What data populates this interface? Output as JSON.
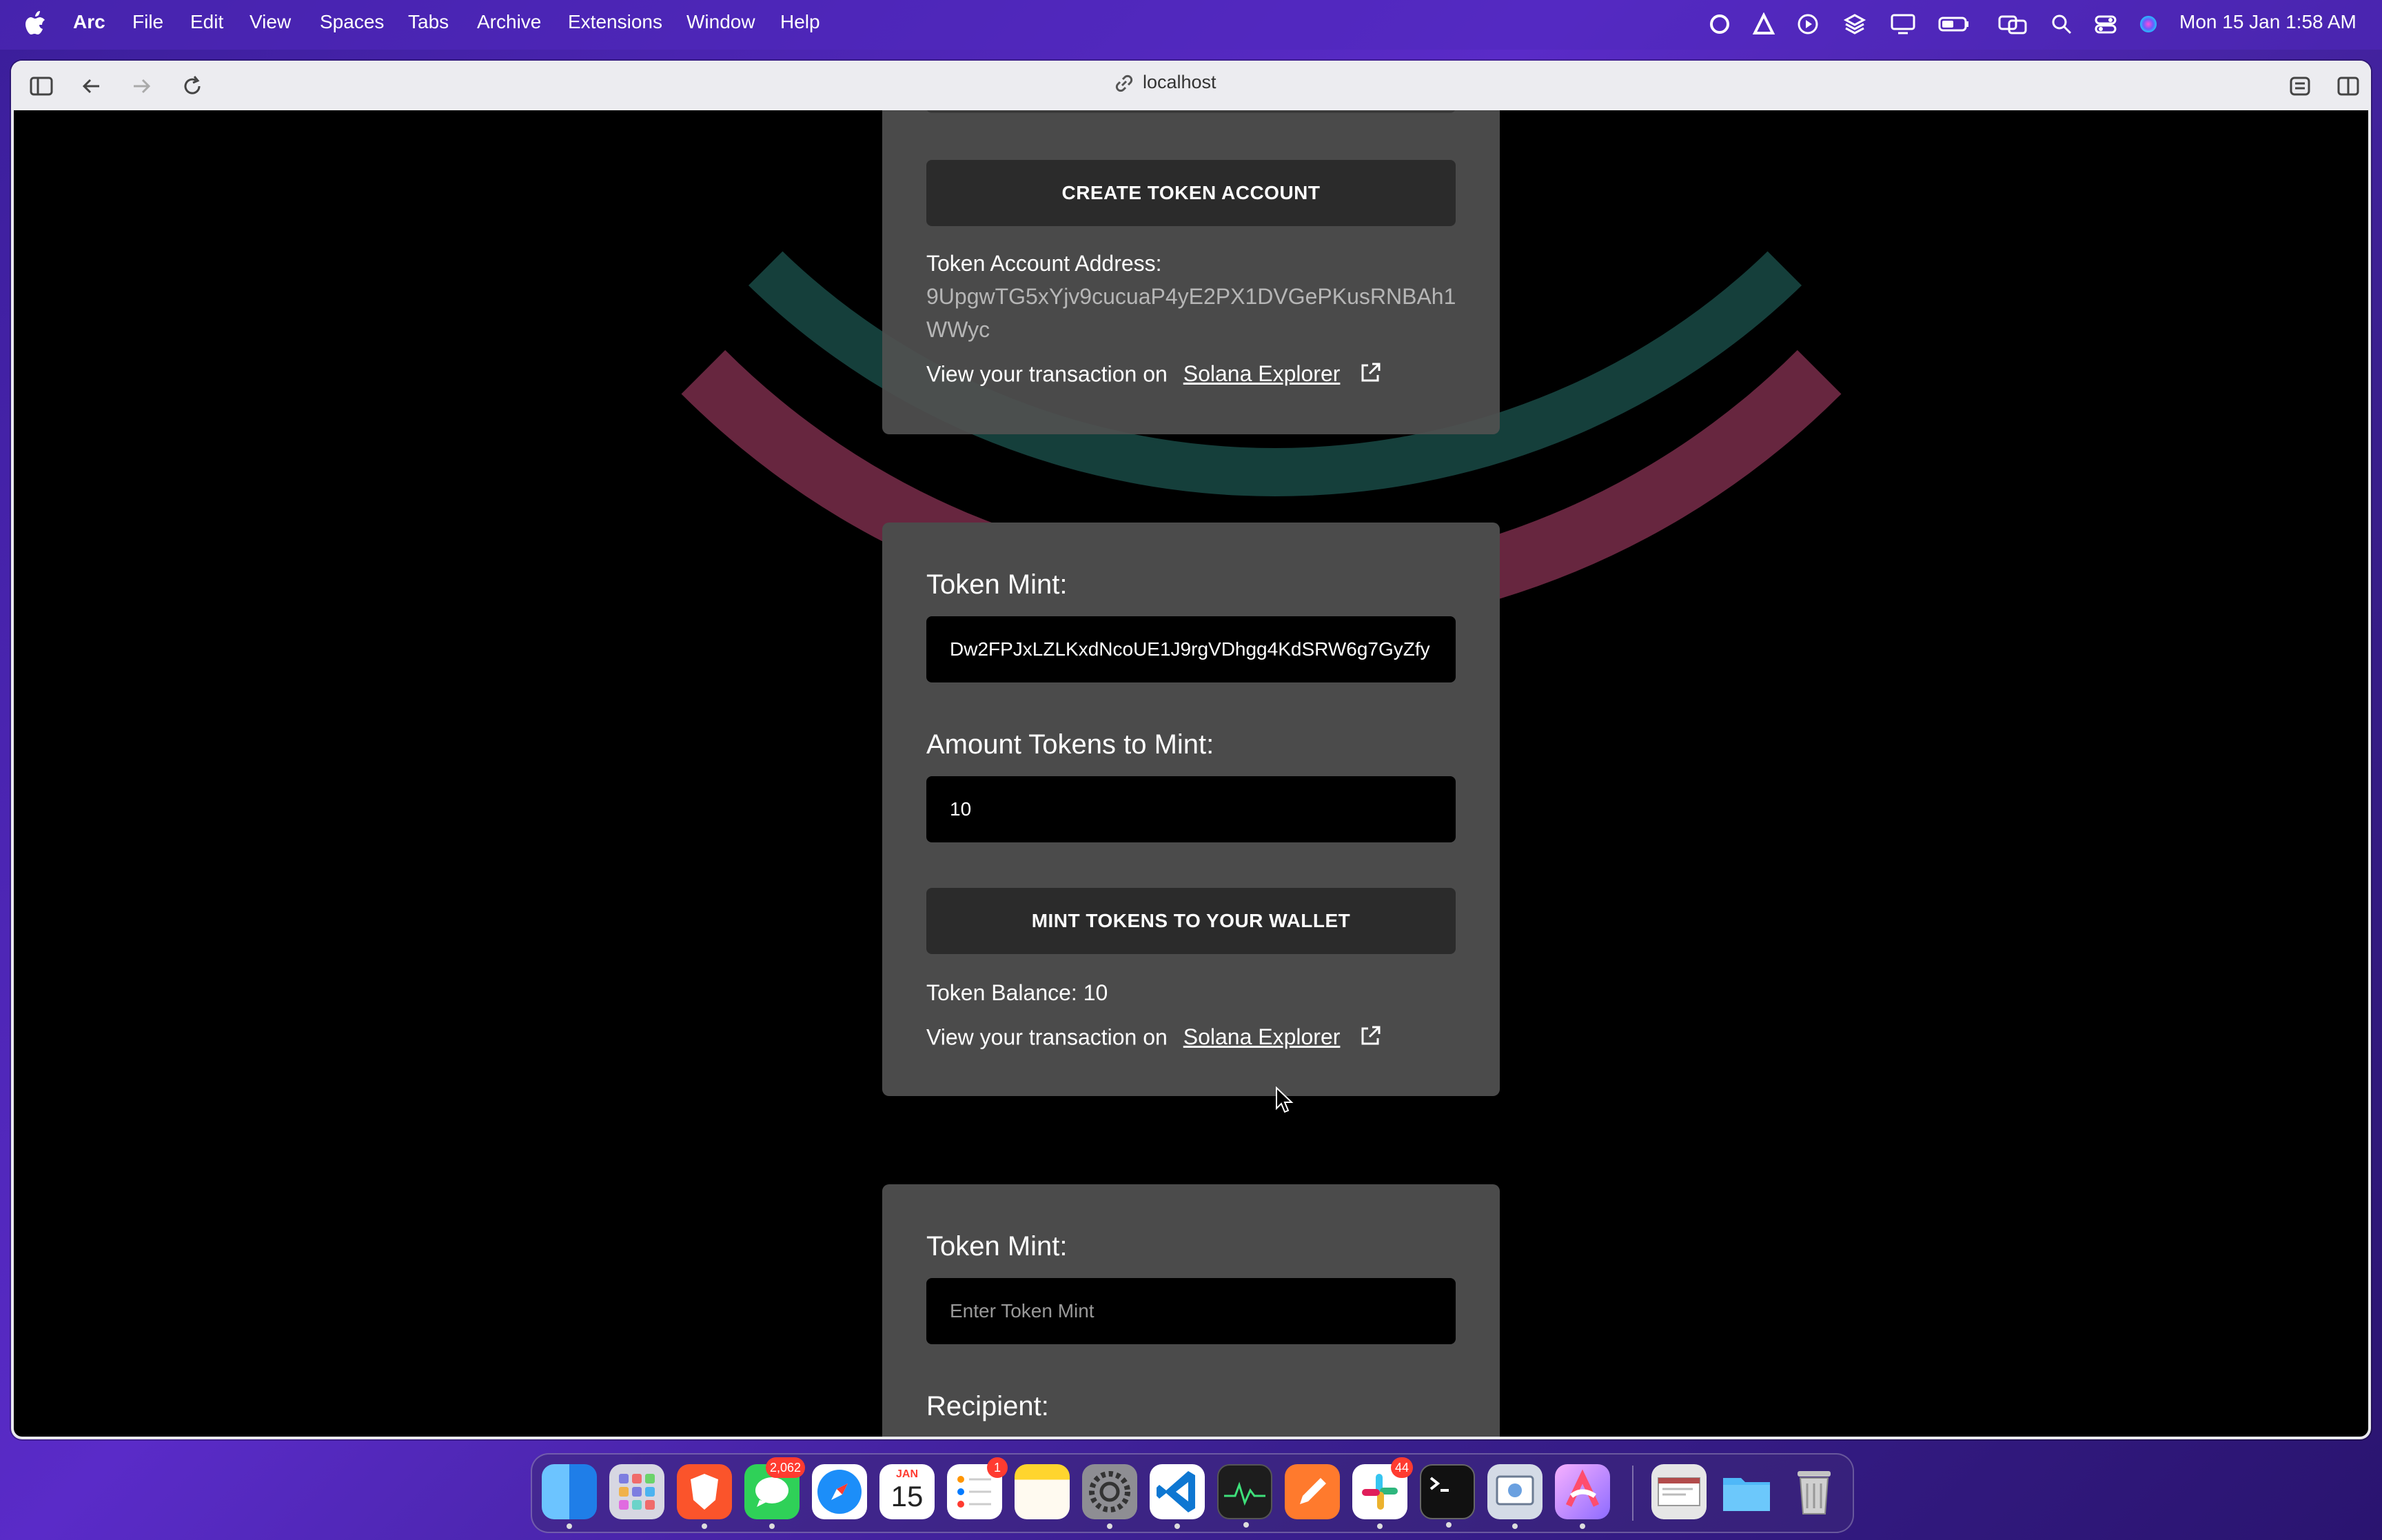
{
  "menubar": {
    "apple_icon": "apple-logo-icon",
    "app_name": "Arc",
    "items": [
      "File",
      "Edit",
      "View",
      "Spaces",
      "Tabs",
      "Archive",
      "Extensions",
      "Window",
      "Help"
    ],
    "status_icons": [
      "creative-cloud-icon",
      "autodesk-icon",
      "play-circle-icon",
      "stack-icon",
      "display-icon",
      "battery-icon",
      "screen-mirroring-icon",
      "search-icon",
      "control-center-icon",
      "siri-icon"
    ],
    "datetime": "Mon 15 Jan  1:58 AM"
  },
  "browser": {
    "url": "localhost",
    "toolbar_icons": [
      "sidebar-toggle-icon",
      "back-arrow-icon",
      "forward-arrow-icon",
      "reload-icon",
      "site-controls-icon",
      "split-view-icon"
    ]
  },
  "card1": {
    "button": "CREATE TOKEN ACCOUNT",
    "address_label": "Token Account Address:",
    "address_line1": "9UpgwTG5xYjv9cucuaP4yE2PX1DVGePKusRNBAh1",
    "address_line2": "WWyc",
    "tx_prefix": "View your transaction on",
    "tx_link": "Solana Explorer"
  },
  "card2": {
    "mint_label": "Token Mint:",
    "mint_value": "Dw2FPJxLZLKxdNcoUE1J9rgVDhgg4KdSRW6g7GyZfy",
    "amount_label": "Amount Tokens to Mint:",
    "amount_value": "10",
    "button": "MINT TOKENS TO YOUR WALLET",
    "balance": "Token Balance: 10",
    "tx_prefix": "View your transaction on",
    "tx_link": "Solana Explorer"
  },
  "card3": {
    "mint_label": "Token Mint:",
    "mint_placeholder": "Enter Token Mint",
    "recipient_label": "Recipient:"
  },
  "dock": {
    "apps": [
      {
        "name": "finder-icon",
        "color": "#2f8ef5"
      },
      {
        "name": "launchpad-icon",
        "color": "#c9c9d6"
      },
      {
        "name": "brave-icon",
        "color": "#fb542b"
      },
      {
        "name": "messages-icon",
        "color": "#2fd158",
        "badge": "2,062"
      },
      {
        "name": "safari-icon",
        "color": "#1c8ef9"
      },
      {
        "name": "calendar-icon",
        "color": "#ffffff",
        "month": "JAN",
        "day": "15"
      },
      {
        "name": "reminders-icon",
        "color": "#ffffff",
        "badge": "1"
      },
      {
        "name": "notes-icon",
        "color": "#ffd52e"
      },
      {
        "name": "system-settings-icon",
        "color": "#8e8e93"
      },
      {
        "name": "vscode-icon",
        "color": "#0e77d2"
      },
      {
        "name": "activity-monitor-icon",
        "color": "#1d1d1d"
      },
      {
        "name": "pen-app-icon",
        "color": "#ff7a2d"
      },
      {
        "name": "slack-icon",
        "color": "#ffffff",
        "badge": "44"
      },
      {
        "name": "terminal-icon",
        "color": "#111111"
      },
      {
        "name": "preview-icon",
        "color": "#d4dbe6"
      },
      {
        "name": "arc-icon",
        "color": "#b590ff"
      },
      {
        "name": "screenshot-icon",
        "color": "#e6e6e6"
      },
      {
        "name": "folder-icon",
        "color": "#4fb8f8"
      },
      {
        "name": "trash-icon",
        "color": "#c4c4c4"
      }
    ]
  }
}
